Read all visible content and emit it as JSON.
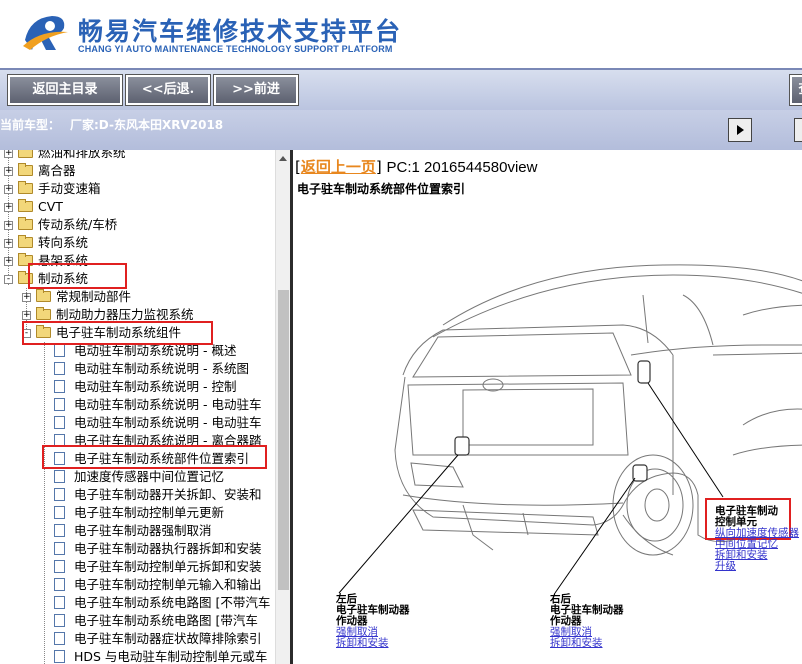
{
  "header": {
    "title": "畅易汽车维修技术支持平台",
    "subtitle": "CHANG YI AUTO MAINTENANCE TECHNOLOGY SUPPORT PLATFORM"
  },
  "toolbar": {
    "home_label": "返回主目录",
    "back_label": "<<后退.",
    "forward_label": ">>前进",
    "edge_label": "查"
  },
  "vehicle": {
    "label": "当前车型：",
    "value": "厂家:D-东风本田XRV2018"
  },
  "tree": {
    "items": [
      {
        "label": "燃油和排放系统",
        "type": "folder",
        "level": 0,
        "expander": "+"
      },
      {
        "label": "离合器",
        "type": "folder",
        "level": 0,
        "expander": "+"
      },
      {
        "label": "手动变速箱",
        "type": "folder",
        "level": 0,
        "expander": "+"
      },
      {
        "label": "CVT",
        "type": "folder",
        "level": 0,
        "expander": "+"
      },
      {
        "label": "传动系统/车桥",
        "type": "folder",
        "level": 0,
        "expander": "+"
      },
      {
        "label": "转向系统",
        "type": "folder",
        "level": 0,
        "expander": "+"
      },
      {
        "label": "悬架系统",
        "type": "folder",
        "level": 0,
        "expander": "+"
      },
      {
        "label": "制动系统",
        "type": "folder",
        "level": 0,
        "expander": "-"
      },
      {
        "label": "常规制动部件",
        "type": "folder",
        "level": 1,
        "expander": "+"
      },
      {
        "label": "制动助力器压力监视系统",
        "type": "folder",
        "level": 1,
        "expander": "+"
      },
      {
        "label": "电子驻车制动系统组件",
        "type": "folder",
        "level": 1,
        "expander": "-"
      },
      {
        "label": "电动驻车制动系统说明 - 概述",
        "type": "doc",
        "level": 2
      },
      {
        "label": "电动驻车制动系统说明 - 系统图",
        "type": "doc",
        "level": 2
      },
      {
        "label": "电动驻车制动系统说明 - 控制",
        "type": "doc",
        "level": 2
      },
      {
        "label": "电动驻车制动系统说明 - 电动驻车",
        "type": "doc",
        "level": 2
      },
      {
        "label": "电动驻车制动系统说明 - 电动驻车",
        "type": "doc",
        "level": 2
      },
      {
        "label": "电子驻车制动系统说明 - 离合器踏",
        "type": "doc",
        "level": 2
      },
      {
        "label": "电子驻车制动系统部件位置索引",
        "type": "doc",
        "level": 2
      },
      {
        "label": "加速度传感器中间位置记忆",
        "type": "doc",
        "level": 2
      },
      {
        "label": "电子驻车制动器开关拆卸、安装和",
        "type": "doc",
        "level": 2
      },
      {
        "label": "电子驻车制动控制单元更新",
        "type": "doc",
        "level": 2
      },
      {
        "label": "电子驻车制动器强制取消",
        "type": "doc",
        "level": 2
      },
      {
        "label": "电子驻车制动器执行器拆卸和安装",
        "type": "doc",
        "level": 2
      },
      {
        "label": "电子驻车制动控制单元拆卸和安装",
        "type": "doc",
        "level": 2
      },
      {
        "label": "电子驻车制动控制单元输入和输出",
        "type": "doc",
        "level": 2
      },
      {
        "label": "电子驻车制动系统电路图 [不带汽车",
        "type": "doc",
        "level": 2
      },
      {
        "label": "电子驻车制动系统电路图 [带汽车",
        "type": "doc",
        "level": 2
      },
      {
        "label": "电子驻车制动器症状故障排除索引",
        "type": "doc",
        "level": 2
      },
      {
        "label": "HDS 与电动驻车制动控制单元或车",
        "type": "doc",
        "level": 2
      }
    ]
  },
  "content": {
    "back_link": "返回上一页",
    "pc_text": "PC:1 2016544580view",
    "doc_title": "电子驻车制动系统部件位置索引",
    "callouts": {
      "control_unit": {
        "title_lines": [
          "电子驻车制动",
          "控制单元"
        ],
        "links": [
          "纵向加速度传感器",
          "中间位置记忆",
          "拆卸和安装",
          "升级"
        ]
      },
      "left_actuator": {
        "title_lines": [
          "左后",
          "电子驻车制动器",
          "作动器"
        ],
        "links": [
          "强制取消",
          "拆卸和安装"
        ]
      },
      "right_actuator": {
        "title_lines": [
          "右后",
          "电子驻车制动器",
          "作动器"
        ],
        "links": [
          "强制取消",
          "拆卸和安装"
        ]
      }
    }
  },
  "colors": {
    "brand_blue": "#2a62b6",
    "toolbar_bg": "#c3cbe4",
    "highlight_red": "#e02020",
    "link_orange": "#e8871e",
    "link_blue": "#3333cc"
  }
}
